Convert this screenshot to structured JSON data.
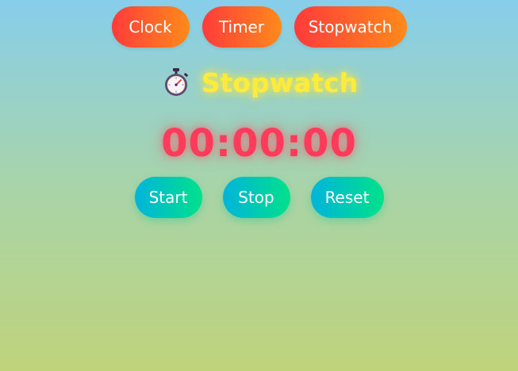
{
  "nav": {
    "tabs": [
      {
        "label": "Clock"
      },
      {
        "label": "Timer"
      },
      {
        "label": "Stopwatch"
      }
    ]
  },
  "header": {
    "icon": "stopwatch-icon",
    "title": "Stopwatch"
  },
  "stopwatch": {
    "time": "00:00:00"
  },
  "controls": {
    "start_label": "Start",
    "stop_label": "Stop",
    "reset_label": "Reset"
  },
  "colors": {
    "tab_gradient": [
      "#ff3b3b",
      "#ff8a1a"
    ],
    "button_gradient": [
      "#00b4db",
      "#00e18a"
    ],
    "title": "#ffeb3b",
    "time": "#ff3b5c",
    "background": [
      "#87ceeb",
      "#bfd37a"
    ]
  }
}
